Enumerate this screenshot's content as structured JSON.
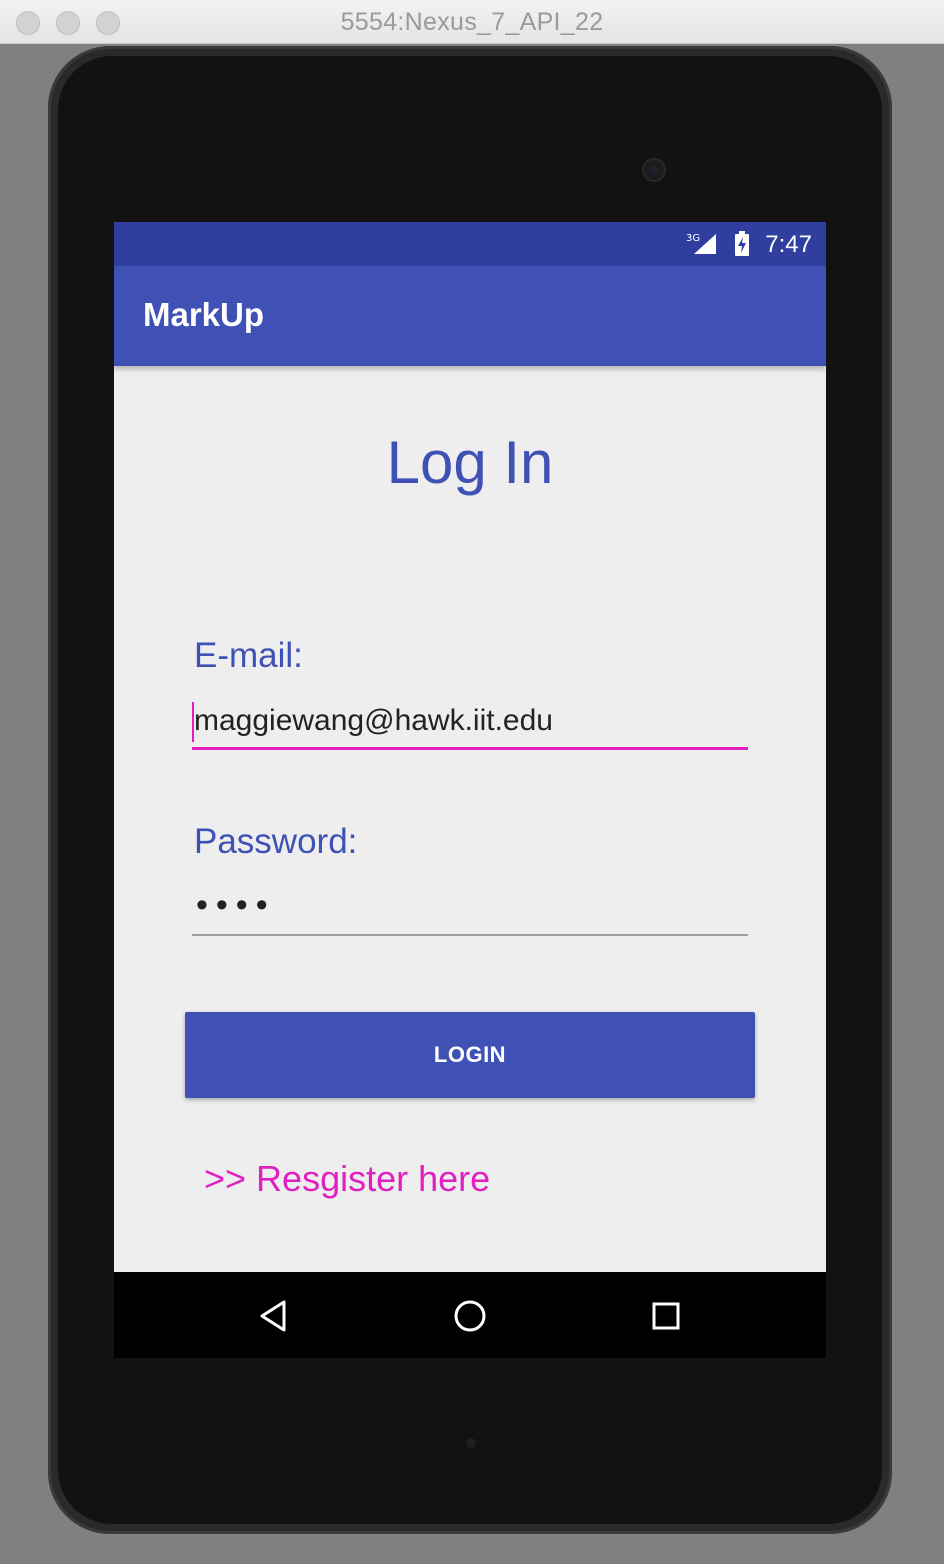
{
  "window": {
    "title": "5554:Nexus_7_API_22"
  },
  "status_bar": {
    "time": "7:47",
    "network": "3G",
    "icons": [
      "signal-icon",
      "battery-icon"
    ]
  },
  "app_bar": {
    "title": "MarkUp"
  },
  "login_form": {
    "heading": "Log In",
    "email_label": "E-mail:",
    "email_value": "maggiewang@hawk.iit.edu",
    "password_label": "Password:",
    "password_value": "••••",
    "login_button": "LOGIN",
    "register_link": ">> Resgister here"
  },
  "nav_bar": {
    "icons": [
      "back-icon",
      "home-icon",
      "recents-icon"
    ]
  },
  "colors": {
    "primary": "#3f51b5",
    "primary_dark": "#303f9f",
    "accent": "#e020c0",
    "background": "#eeeeee"
  }
}
